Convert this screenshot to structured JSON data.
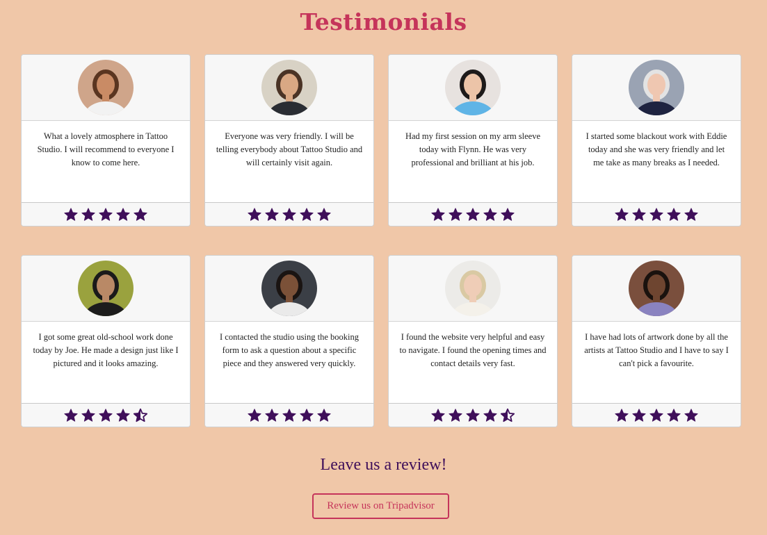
{
  "page": {
    "title": "Testimonials"
  },
  "colors": {
    "background": "#f0c7a8",
    "title": "#c5345a",
    "star": "#3f0f5a",
    "accent": "#c5345a"
  },
  "testimonials": [
    {
      "text": "What a lovely atmosphere in Tattoo Studio. I will recommend to everyone I know to come here.",
      "rating": 5,
      "avatar": {
        "bg": "#cfa58a",
        "hair": "#5a3520",
        "skin": "#c98b65",
        "shirt": "#f2f2f2"
      }
    },
    {
      "text": "Everyone was very friendly. I will be telling everybody about Tattoo Studio and will certainly visit again.",
      "rating": 5,
      "avatar": {
        "bg": "#d8d2c5",
        "hair": "#4a3325",
        "skin": "#d9a884",
        "shirt": "#2a2d33"
      }
    },
    {
      "text": "Had my first session on my arm sleeve today with Flynn. He was very professional and brilliant at his job.",
      "rating": 5,
      "avatar": {
        "bg": "#e7e2df",
        "hair": "#1d1a1a",
        "skin": "#ecc4a8",
        "shirt": "#5fb4e6"
      }
    },
    {
      "text": "I started some blackout work with Eddie today and she was very friendly and let me take as many breaks as I needed.",
      "rating": 5,
      "avatar": {
        "bg": "#9aa3b3",
        "hair": "#e3e3e3",
        "skin": "#efc7b1",
        "shirt": "#1e2340"
      }
    },
    {
      "text": "I got some great old-school work done today by Joe. He made a design just like I pictured and it looks amazing.",
      "rating": 4.5,
      "avatar": {
        "bg": "#9aa23e",
        "hair": "#1a1a1a",
        "skin": "#b98966",
        "shirt": "#1c1c1c"
      }
    },
    {
      "text": "I contacted the studio using the booking form to ask a question about a specific piece and they answered very quickly.",
      "rating": 5,
      "avatar": {
        "bg": "#3b3f46",
        "hair": "#1a1412",
        "skin": "#7b5138",
        "shirt": "#eaeaea"
      }
    },
    {
      "text": "I found the website very helpful and easy to navigate. I found the opening times and contact details very fast.",
      "rating": 4.5,
      "avatar": {
        "bg": "#ecebe8",
        "hair": "#d9c9a3",
        "skin": "#efcdb7",
        "shirt": "#f4f1ea"
      }
    },
    {
      "text": "I have had lots of artwork done by all the artists at Tattoo Studio and I have to say I can't pick a favourite.",
      "rating": 5,
      "avatar": {
        "bg": "#7a4f3d",
        "hair": "#1a120e",
        "skin": "#6e4530",
        "shirt": "#8a83c0"
      }
    }
  ],
  "cta": {
    "heading": "Leave us a review!",
    "button_label": "Review us on Tripadvisor"
  }
}
